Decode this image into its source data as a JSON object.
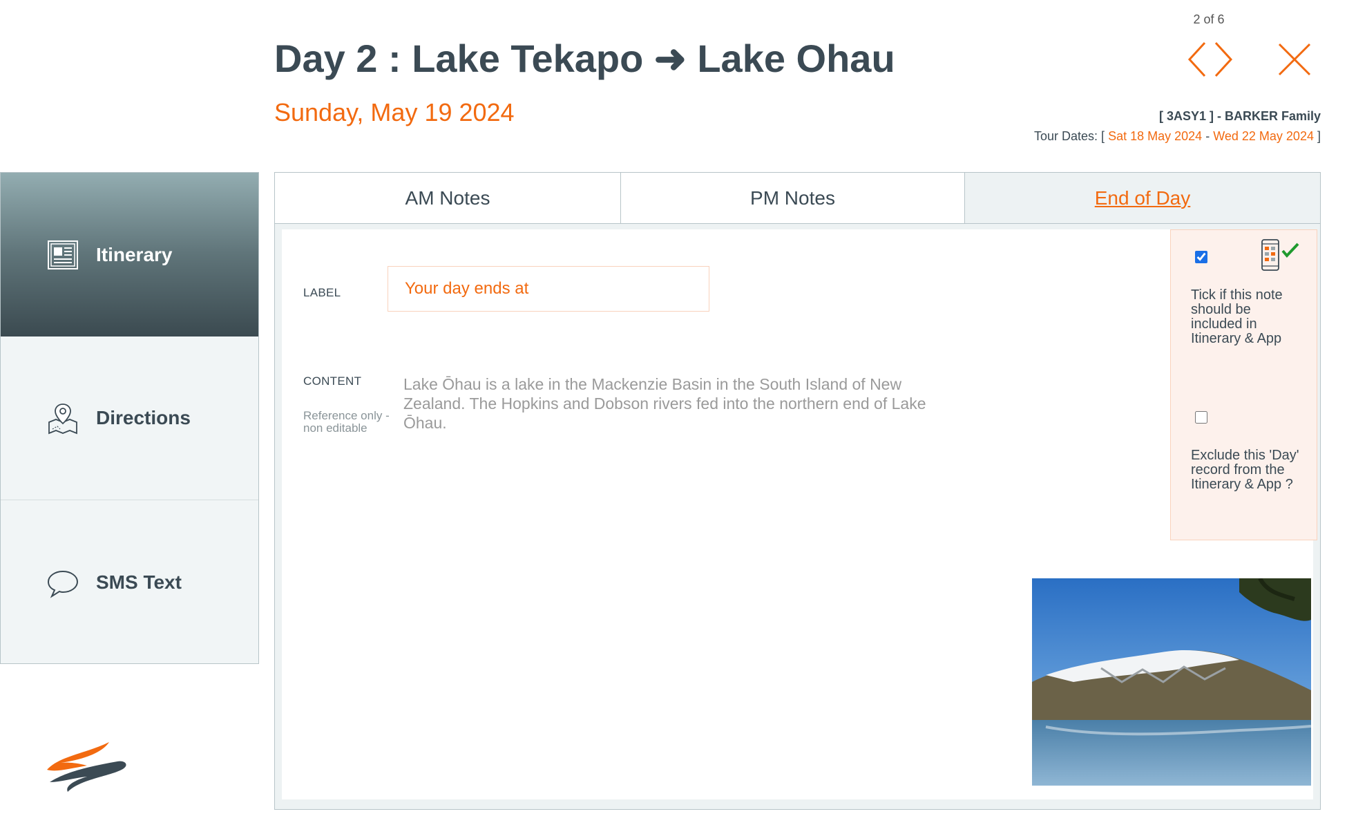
{
  "header": {
    "page_counter": "2 of 6",
    "title": "Day 2 : Lake Tekapo ➜ Lake Ohau",
    "date": "Sunday, May 19 2024",
    "booking_ref": "[ 3ASY1 ] - BARKER Family",
    "tour_dates_prefix": "Tour Dates: [",
    "tour_start": "Sat 18 May 2024",
    "tour_sep": "-",
    "tour_end": "Wed 22 May 2024",
    "tour_dates_suffix": "]"
  },
  "sidebar": {
    "items": [
      {
        "label": "Itinerary",
        "icon": "itinerary-icon",
        "active": true
      },
      {
        "label": "Directions",
        "icon": "map-pin-icon",
        "active": false
      },
      {
        "label": "SMS Text",
        "icon": "speech-bubble-icon",
        "active": false
      }
    ]
  },
  "tabs": [
    {
      "label": "AM Notes",
      "active": false
    },
    {
      "label": "PM Notes",
      "active": false
    },
    {
      "label": "End of Day",
      "active": true
    }
  ],
  "form": {
    "label_caption": "LABEL",
    "label_value": "Your day ends at",
    "content_caption": "CONTENT",
    "reference_note": "Reference only - non editable",
    "content_text": "Lake Ōhau is a lake in the Mackenzie Basin in the South Island of New Zealand. The Hopkins and Dobson rivers fed into the northern end of Lake Ōhau."
  },
  "options": {
    "include_checked": true,
    "include_text": "Tick if this note should be included in Itinerary & App",
    "exclude_checked": false,
    "exclude_text": "Exclude this 'Day' record from the Itinerary & App ?"
  },
  "colors": {
    "accent": "#f26a10",
    "text_dark": "#3b4a54",
    "sidebar_active_top": "#93adb1",
    "sidebar_active_bottom": "#3b4a50",
    "border": "#b7c4c8"
  }
}
